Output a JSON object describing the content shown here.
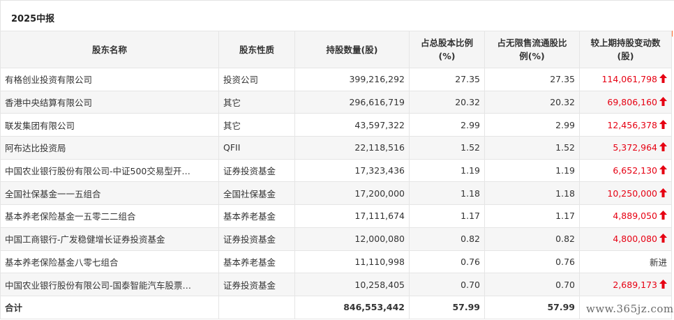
{
  "period": {
    "label": "2025中报"
  },
  "table": {
    "headers": [
      "股东名称",
      "股东性质",
      "持股数量(股)",
      "占总股本比例(%)",
      "占无限售流通股比例(%)",
      "较上期持股变动数(股)"
    ],
    "header_lines": {
      "ratio_total": [
        "占总股本比例",
        "(%)"
      ],
      "ratio_float": [
        "占无限售流通股比",
        "例(%)"
      ],
      "change": [
        "较上期持股变动数",
        "(股)"
      ]
    },
    "rows": [
      {
        "name": "有格创业投资有限公司",
        "type": "投资公司",
        "shares": "399,216,292",
        "pct_total": "27.35",
        "pct_float": "27.35",
        "change": "114,061,798",
        "direction": "up"
      },
      {
        "name": "香港中央结算有限公司",
        "type": "其它",
        "shares": "296,616,719",
        "pct_total": "20.32",
        "pct_float": "20.32",
        "change": "69,806,160",
        "direction": "up"
      },
      {
        "name": "联发集团有限公司",
        "type": "其它",
        "shares": "43,597,322",
        "pct_total": "2.99",
        "pct_float": "2.99",
        "change": "12,456,378",
        "direction": "up"
      },
      {
        "name": "阿布达比投资局",
        "type": "QFII",
        "shares": "22,118,516",
        "pct_total": "1.52",
        "pct_float": "1.52",
        "change": "5,372,964",
        "direction": "up"
      },
      {
        "name": "中国农业银行股份有限公司-中证500交易型开…",
        "type": "证券投资基金",
        "shares": "17,323,436",
        "pct_total": "1.19",
        "pct_float": "1.19",
        "change": "6,652,130",
        "direction": "up"
      },
      {
        "name": "全国社保基金一一五组合",
        "type": "全国社保基金",
        "shares": "17,200,000",
        "pct_total": "1.18",
        "pct_float": "1.18",
        "change": "10,250,000",
        "direction": "up"
      },
      {
        "name": "基本养老保险基金一五零二二组合",
        "type": "基本养老基金",
        "shares": "17,111,674",
        "pct_total": "1.17",
        "pct_float": "1.17",
        "change": "4,889,050",
        "direction": "up"
      },
      {
        "name": "中国工商银行-广发稳健增长证券投资基金",
        "type": "证券投资基金",
        "shares": "12,000,080",
        "pct_total": "0.82",
        "pct_float": "0.82",
        "change": "4,800,080",
        "direction": "up"
      },
      {
        "name": "基本养老保险基金八零七组合",
        "type": "基本养老基金",
        "shares": "11,110,998",
        "pct_total": "0.76",
        "pct_float": "0.76",
        "change": "新进",
        "direction": "new"
      },
      {
        "name": "中国农业银行股份有限公司-国泰智能汽车股票…",
        "type": "证券投资基金",
        "shares": "10,258,405",
        "pct_total": "0.70",
        "pct_float": "0.70",
        "change": "2,689,173",
        "direction": "up"
      }
    ],
    "total": {
      "label": "合计",
      "shares": "846,553,442",
      "pct_total": "57.99",
      "pct_float": "57.99"
    }
  },
  "colors": {
    "increase": "#e60012",
    "header_bg": "#f5f5f5",
    "stripe_bg": "#f6f6f6",
    "corner_flag": "#ff6a2b"
  },
  "icons": {
    "increase": "up-arrow-icon"
  },
  "watermark": "www.365jz.com"
}
